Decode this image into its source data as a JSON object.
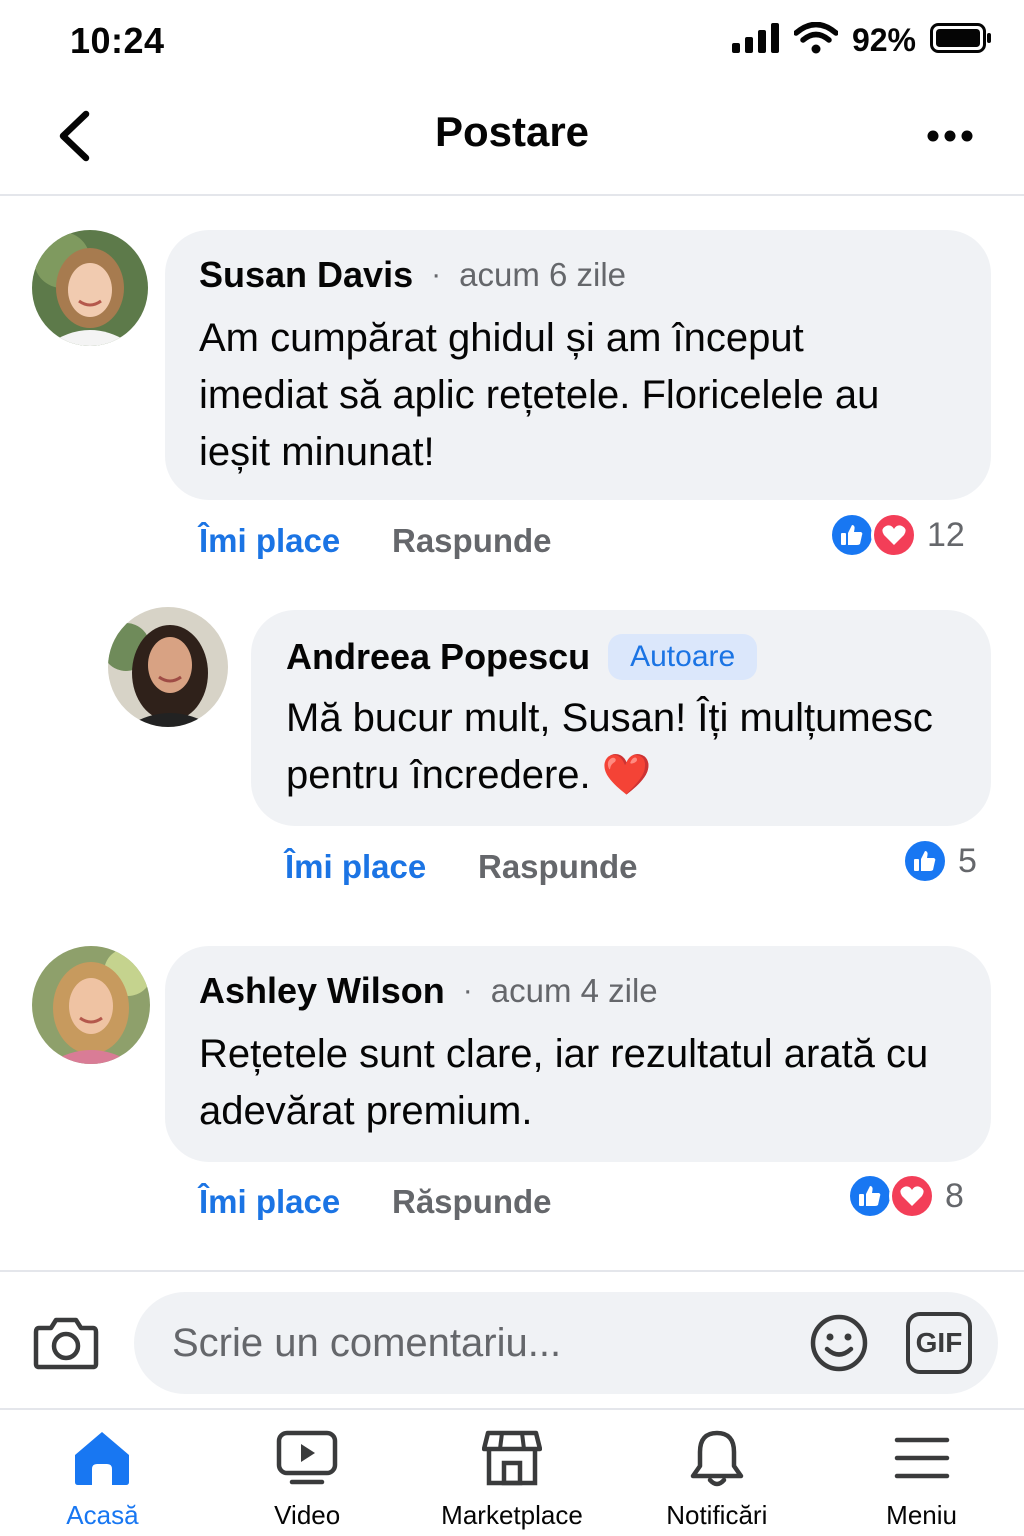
{
  "status_bar": {
    "time": "10:24",
    "battery": "92%"
  },
  "header": {
    "title": "Postare"
  },
  "comments": [
    {
      "author": "Susan Davis",
      "time": "acum 6 zile",
      "text": "Am cumpărat ghidul și am început imediat să aplic rețetele. Floricelele au ieșit minunat!",
      "like_label": "Îmi place",
      "reply_label": "Raspunde",
      "reaction_count": "12"
    },
    {
      "author": "Andreea Popescu",
      "badge": "Autoare",
      "text": "Mă bucur mult, Susan! Îți mulțumesc pentru încredere. ❤️",
      "like_label": "Îmi place",
      "reply_label": "Raspunde",
      "reaction_count": "5"
    },
    {
      "author": "Ashley Wilson",
      "time": "acum 4 zile",
      "text": "Rețetele sunt clare, iar rezultatul arată cu adevărat premium.",
      "like_label": "Îmi place",
      "reply_label": "Răspunde",
      "reaction_count": "8"
    }
  ],
  "composer": {
    "placeholder": "Scrie un comentariu...",
    "gif_label": "GIF"
  },
  "bottom_nav": [
    {
      "label": "Acasă",
      "icon": "home-icon",
      "active": true
    },
    {
      "label": "Video",
      "icon": "video-icon"
    },
    {
      "label": "Marketplace",
      "icon": "marketplace-icon"
    },
    {
      "label": "Notificări",
      "icon": "bell-icon"
    },
    {
      "label": "Meniu",
      "icon": "menu-icon"
    }
  ],
  "colors": {
    "accent": "#1877f2",
    "love": "#f33e58",
    "bubble": "#f0f2f5",
    "muted": "#65676b"
  }
}
